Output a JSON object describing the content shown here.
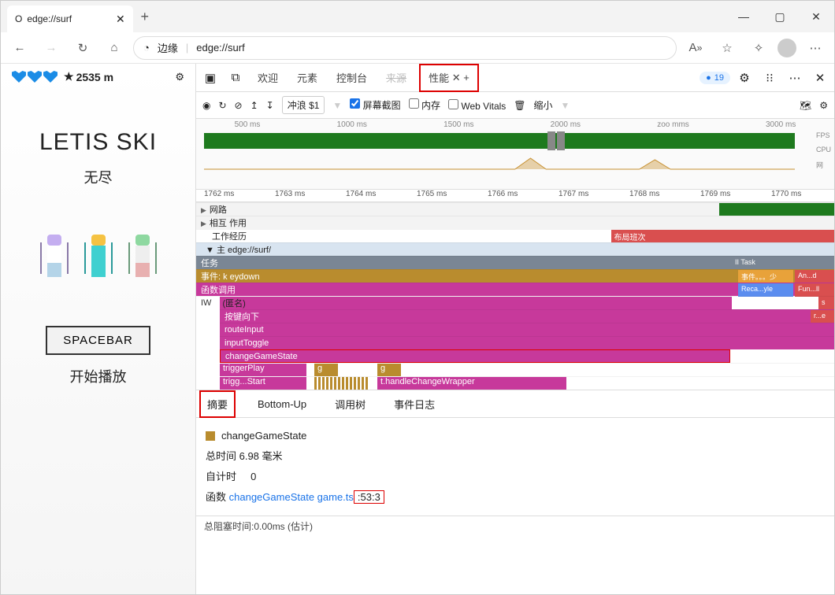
{
  "browser": {
    "tab_title": "edge://surf",
    "site_label": "边缘",
    "url": "edge://surf"
  },
  "window": {
    "min": "—",
    "max": "▢",
    "close": "✕"
  },
  "game": {
    "score_label": "2535 m",
    "title": "LETIS SKI",
    "subtitle": "无尽",
    "space_button": "SPACEBAR",
    "start_text": "开始播放"
  },
  "devtools_tabs": {
    "welcome": "欢迎",
    "elements": "元素",
    "console": "控制台",
    "sources": "来源",
    "performance": "性能",
    "perf_close": "✕",
    "perf_plus": "+",
    "issues": "19",
    "close": "✕"
  },
  "toolbar": {
    "profile_sel": "冲浪 $1",
    "screenshot": "屏幕截图",
    "memory": "内存",
    "webvitals": "Web Vitals",
    "shrink": "缩小"
  },
  "overview_ticks": [
    "500 ms",
    "1000 ms",
    "1500 ms",
    "2000 ms",
    "zoo mms",
    "3000 ms"
  ],
  "overview_labels": {
    "fps": "FPS",
    "cpu": "CPU",
    "net": "网"
  },
  "ruler": [
    "1762 ms",
    "1763 ms",
    "1764 ms",
    "1765 ms",
    "1766 ms",
    "1767 ms",
    "1768 ms",
    "1769 ms",
    "1770 ms"
  ],
  "flame": {
    "network": "网路",
    "interaction": "相互 作用",
    "work": "工作经历",
    "layout_shift": "布局班次",
    "main": "主 edge://surf/",
    "task": "任务",
    "task_right": "II Task",
    "event": "事件: k eydown",
    "event_r1": "事件。。。少",
    "event_r2": "An...d",
    "fncall": "函数调用",
    "fn_r1": "Reca...yle",
    "fn_r2": "Fun...ll",
    "anon": "(匿名)",
    "anon_r": "s",
    "down": "按键向下",
    "down_r": "r...e",
    "route": "routeInput",
    "toggle": "inputToggle",
    "change": "changeGameState",
    "trigger": "triggerPlay",
    "g1": "g",
    "g2": "g",
    "trigstart": "trigg...Start",
    "wrapper": "t.handleChangeWrapper",
    "iw": "IW"
  },
  "bottom_tabs": {
    "summary": "摘要",
    "bottomup": "Bottom-Up",
    "calltree": "调用树",
    "eventlog": "事件日志"
  },
  "summary": {
    "fn_name": "changeGameState",
    "total": "总时间 6.98 毫米",
    "self_label": "自计时",
    "self_val": "0",
    "fn_label": "函数",
    "fn_link": "changeGameState game.ts",
    "fn_pos": ":53:3"
  },
  "status": "总阻塞时间:0.00ms (估计)"
}
